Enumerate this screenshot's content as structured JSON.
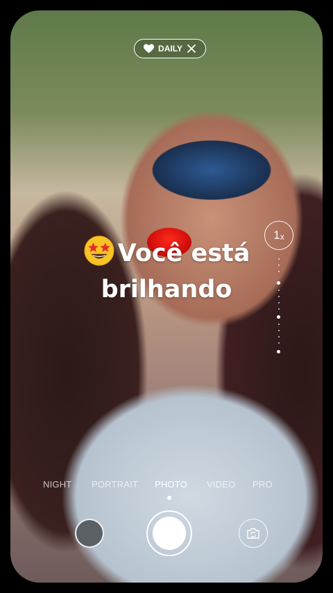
{
  "badge": {
    "label": "DAILY",
    "icon": "heart-icon",
    "close_icon": "close-icon"
  },
  "caption": {
    "emoji_icon": "star-struck-emoji-icon",
    "line1": "Você está",
    "line2": "brilhando"
  },
  "zoom": {
    "value": "1",
    "suffix": "x"
  },
  "modes": [
    {
      "label": "NIGHT",
      "active": false
    },
    {
      "label": "PORTRAIT",
      "active": false
    },
    {
      "label": "PHOTO",
      "active": true
    },
    {
      "label": "VIDEO",
      "active": false
    },
    {
      "label": "PRO",
      "active": false
    }
  ],
  "controls": {
    "gallery_icon": "gallery-thumbnail",
    "shutter_icon": "shutter-icon",
    "flip_icon": "flip-camera-icon"
  },
  "colors": {
    "accent": "#ffffff",
    "lips": "#e0140e"
  }
}
